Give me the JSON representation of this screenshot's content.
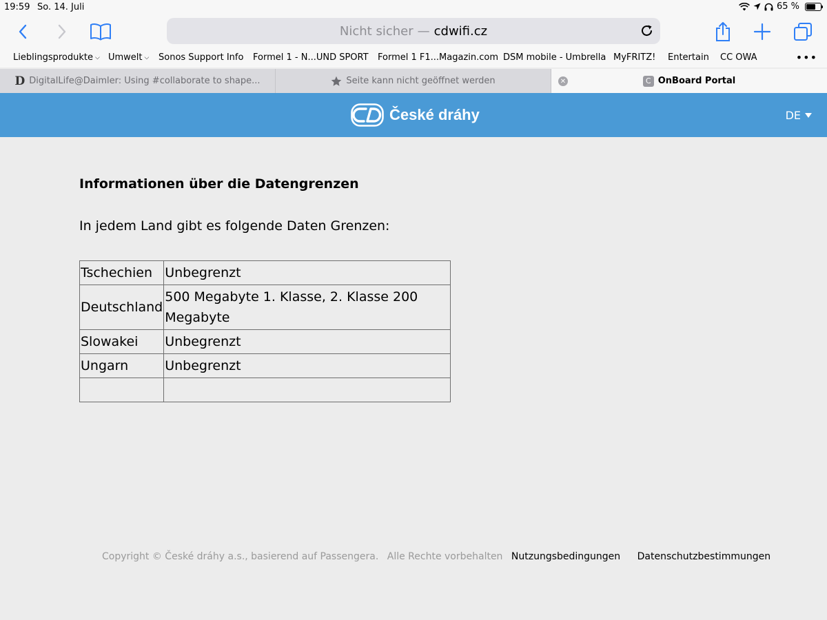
{
  "status_bar": {
    "time": "19:59",
    "date": "So. 14. Juli",
    "battery": "65 %",
    "battery_level": 0.65
  },
  "browser": {
    "address": {
      "security_label": "Nicht sicher",
      "separator": "—",
      "host": "cdwifi.cz"
    },
    "icons": [
      "back-icon",
      "forward-icon",
      "bookmarks-icon",
      "reload-icon",
      "share-icon",
      "new-tab-icon",
      "tabs-overview-icon"
    ],
    "accent_color": "#2f7ff6",
    "bookmarks": [
      {
        "label": "Lieblingsprodukte",
        "has_menu": true
      },
      {
        "label": "Umwelt",
        "has_menu": true
      },
      {
        "label": "Sonos Support Info",
        "has_menu": false
      },
      {
        "label": "Formel 1 - N...UND SPORT",
        "has_menu": false
      },
      {
        "label": "Formel 1 F1...Magazin.com",
        "has_menu": false
      },
      {
        "label": "DSM mobile - Umbrella",
        "has_menu": false
      },
      {
        "label": "MyFRITZ!",
        "has_menu": false
      },
      {
        "label": "Entertain",
        "has_menu": false
      },
      {
        "label": "CC OWA",
        "has_menu": false
      }
    ],
    "more_label": "•••",
    "tabs": [
      {
        "favicon": "D",
        "title": "DigitalLife@Daimler: Using #collaborate to shape..."
      },
      {
        "favicon": "star",
        "title": "Seite kann nicht geöffnet werden"
      },
      {
        "favicon": "C",
        "title": "OnBoard Portal",
        "active": true
      }
    ]
  },
  "header": {
    "brand": "České dráhy",
    "language": "DE",
    "background_color": "#4a9ad6"
  },
  "main": {
    "title": "Informationen über die Datengrenzen",
    "intro": "In jedem Land gibt es folgende Daten Grenzen:",
    "table": [
      {
        "country": "Tschechien",
        "limit": "Unbegrenzt"
      },
      {
        "country": "Deutschland",
        "limit": "500 Megabyte 1. Klasse, 2. Klasse 200 Megabyte"
      },
      {
        "country": "Slowakei",
        "limit": "Unbegrenzt"
      },
      {
        "country": "Ungarn",
        "limit": "Unbegrenzt"
      },
      {
        "country": "",
        "limit": ""
      }
    ]
  },
  "footer": {
    "copyright": "Copyright © České dráhy a.s., basierend auf Passengera.",
    "rights": "Alle Rechte vorbehalten",
    "terms": "Nutzungsbedingungen",
    "privacy": "Datenschutzbestimmungen"
  }
}
